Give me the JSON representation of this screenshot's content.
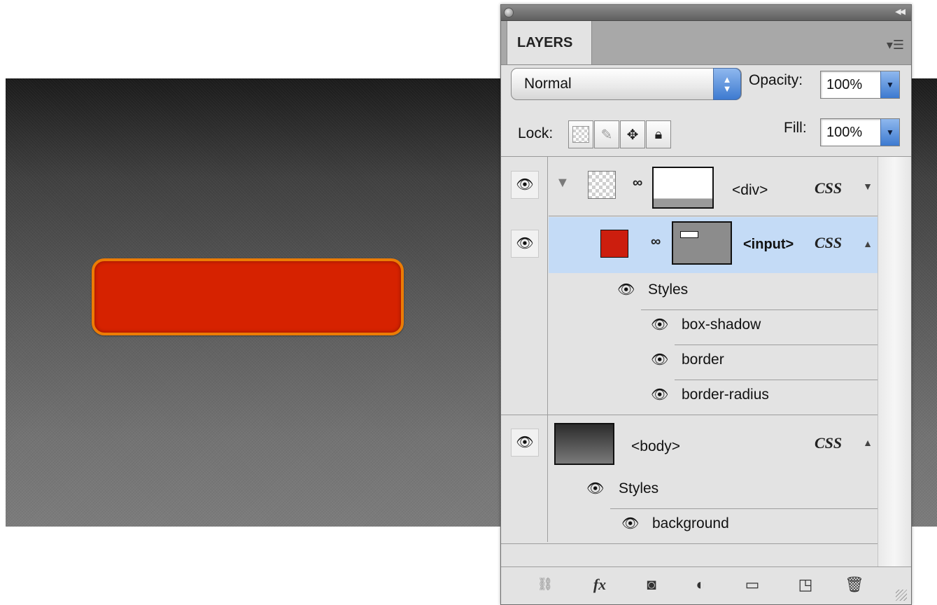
{
  "panel": {
    "tab_label": "LAYERS",
    "blend_mode": "Normal",
    "opacity_label": "Opacity:",
    "opacity_value": "100%",
    "lock_label": "Lock:",
    "fill_label": "Fill:",
    "fill_value": "100%"
  },
  "layers": {
    "div": {
      "name": "<div>",
      "tag": "CSS"
    },
    "input": {
      "name": "<input>",
      "tag": "CSS",
      "swatch_color": "#cc1e0e",
      "styles_label": "Styles",
      "styles": [
        "box-shadow",
        "border",
        "border-radius"
      ]
    },
    "body": {
      "name": "<body>",
      "tag": "CSS",
      "styles_label": "Styles",
      "styles": [
        "background"
      ]
    }
  },
  "colors": {
    "input_fill": "#d62200",
    "input_border": "#ec7c05",
    "selection": "#c4dbf6"
  },
  "toolbar_icons": [
    "link-layers-icon",
    "fx-icon",
    "mask-icon",
    "adjustment-icon",
    "folder-icon",
    "new-layer-icon",
    "trash-icon"
  ],
  "toolbar_labels": {
    "fx": "fx"
  }
}
